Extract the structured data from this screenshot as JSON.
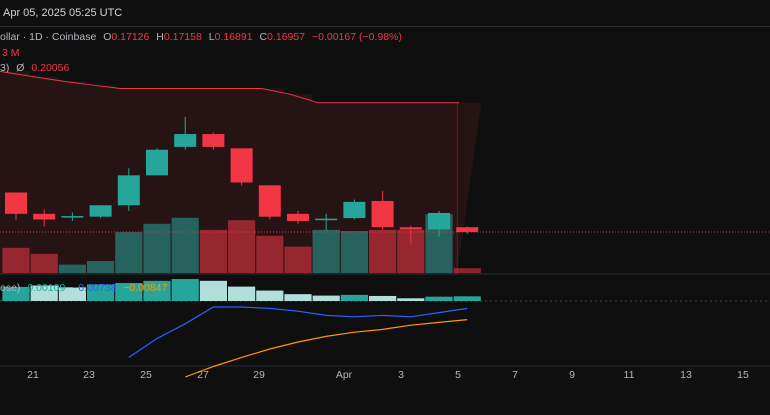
{
  "header": {
    "datetime": "Apr 05, 2025 05:25 UTC"
  },
  "symbol_legend": {
    "name": "ollar · 1D · Coinbase",
    "open_label": "O",
    "open": "0.17126",
    "high_label": "H",
    "high": "0.17158",
    "low_label": "L",
    "low": "0.16891",
    "close_label": "C",
    "close": "0.16957",
    "change": "−0.00167 (−0.98%)"
  },
  "volume_legend": {
    "value": "3 M"
  },
  "indicator_legend": {
    "name": "3)",
    "symbol": "Ø",
    "value": "0.20056"
  },
  "histogram_legend": {
    "name": "ose)",
    "v1": "0.00109",
    "v2": "−0.00738",
    "v3": "−0.00847"
  },
  "colors": {
    "up": "#26a69a",
    "down": "#f23645",
    "band": "#f23645",
    "line_blue": "#2962ff",
    "line_orange": "#ff9800"
  },
  "chart_data": {
    "type": "candlestick",
    "x_labels": [
      "21",
      "23",
      "25",
      "27",
      "29",
      "Apr",
      "3",
      "5",
      "7",
      "9",
      "11",
      "13",
      "15"
    ],
    "candles": [
      {
        "o": 0.1835,
        "h": 0.1835,
        "l": 0.174,
        "c": 0.176
      },
      {
        "o": 0.176,
        "h": 0.1775,
        "l": 0.1715,
        "c": 0.174
      },
      {
        "o": 0.175,
        "h": 0.1765,
        "l": 0.1735,
        "c": 0.1752
      },
      {
        "o": 0.175,
        "h": 0.179,
        "l": 0.1745,
        "c": 0.179
      },
      {
        "o": 0.179,
        "h": 0.192,
        "l": 0.177,
        "c": 0.1895
      },
      {
        "o": 0.1895,
        "h": 0.199,
        "l": 0.1895,
        "c": 0.1985
      },
      {
        "o": 0.1995,
        "h": 0.21,
        "l": 0.1985,
        "c": 0.204
      },
      {
        "o": 0.204,
        "h": 0.2045,
        "l": 0.1985,
        "c": 0.1995
      },
      {
        "o": 0.199,
        "h": 0.199,
        "l": 0.186,
        "c": 0.187
      },
      {
        "o": 0.186,
        "h": 0.186,
        "l": 0.174,
        "c": 0.175
      },
      {
        "o": 0.176,
        "h": 0.177,
        "l": 0.1725,
        "c": 0.1735
      },
      {
        "o": 0.174,
        "h": 0.176,
        "l": 0.17,
        "c": 0.1743
      },
      {
        "o": 0.1745,
        "h": 0.181,
        "l": 0.174,
        "c": 0.1802
      },
      {
        "o": 0.1805,
        "h": 0.184,
        "l": 0.1705,
        "c": 0.1713
      },
      {
        "o": 0.1713,
        "h": 0.1718,
        "l": 0.1655,
        "c": 0.1705
      },
      {
        "o": 0.1705,
        "h": 0.177,
        "l": 0.168,
        "c": 0.1763
      },
      {
        "o": 0.1713,
        "h": 0.1716,
        "l": 0.1689,
        "c": 0.1696
      }
    ],
    "volume": [
      0.42,
      0.32,
      0.14,
      0.2,
      0.68,
      0.82,
      0.92,
      0.72,
      0.88,
      0.62,
      0.44,
      0.72,
      0.7,
      0.72,
      0.72,
      0.98,
      0.08
    ],
    "histogram": [
      {
        "v": 0.78,
        "c": "#26a69a"
      },
      {
        "v": 0.86,
        "c": "#b2dfdb"
      },
      {
        "v": 0.76,
        "c": "#b2dfdb"
      },
      {
        "v": 0.92,
        "c": "#26a69a"
      },
      {
        "v": 1.0,
        "c": "#26a69a"
      },
      {
        "v": 1.12,
        "c": "#26a69a"
      },
      {
        "v": 1.22,
        "c": "#26a69a"
      },
      {
        "v": 1.12,
        "c": "#b2dfdb"
      },
      {
        "v": 0.8,
        "c": "#b2dfdb"
      },
      {
        "v": 0.58,
        "c": "#b2dfdb"
      },
      {
        "v": 0.38,
        "c": "#b2dfdb"
      },
      {
        "v": 0.3,
        "c": "#b2dfdb"
      },
      {
        "v": 0.34,
        "c": "#26a69a"
      },
      {
        "v": 0.28,
        "c": "#b2dfdb"
      },
      {
        "v": 0.15,
        "c": "#b2dfdb"
      },
      {
        "v": 0.24,
        "c": "#26a69a"
      },
      {
        "v": 0.26,
        "c": "#26a69a"
      }
    ],
    "band_top": [
      0.226,
      0.224,
      0.2225,
      0.2212,
      0.22,
      0.22,
      0.22,
      0.22,
      0.22,
      0.22,
      0.218,
      0.215,
      0.215,
      0.215,
      0.215,
      0.215,
      0.215
    ],
    "line_blue": [
      null,
      null,
      null,
      null,
      -0.82,
      -0.55,
      -0.34,
      -0.1,
      -0.1,
      -0.12,
      -0.16,
      -0.22,
      -0.24,
      -0.22,
      -0.24,
      -0.18,
      -0.12
    ],
    "line_orange": [
      null,
      null,
      null,
      null,
      null,
      null,
      -1.1,
      -0.95,
      -0.82,
      -0.7,
      -0.6,
      -0.52,
      -0.46,
      -0.42,
      -0.36,
      -0.32,
      -0.28
    ],
    "last_price": 0.1696
  }
}
